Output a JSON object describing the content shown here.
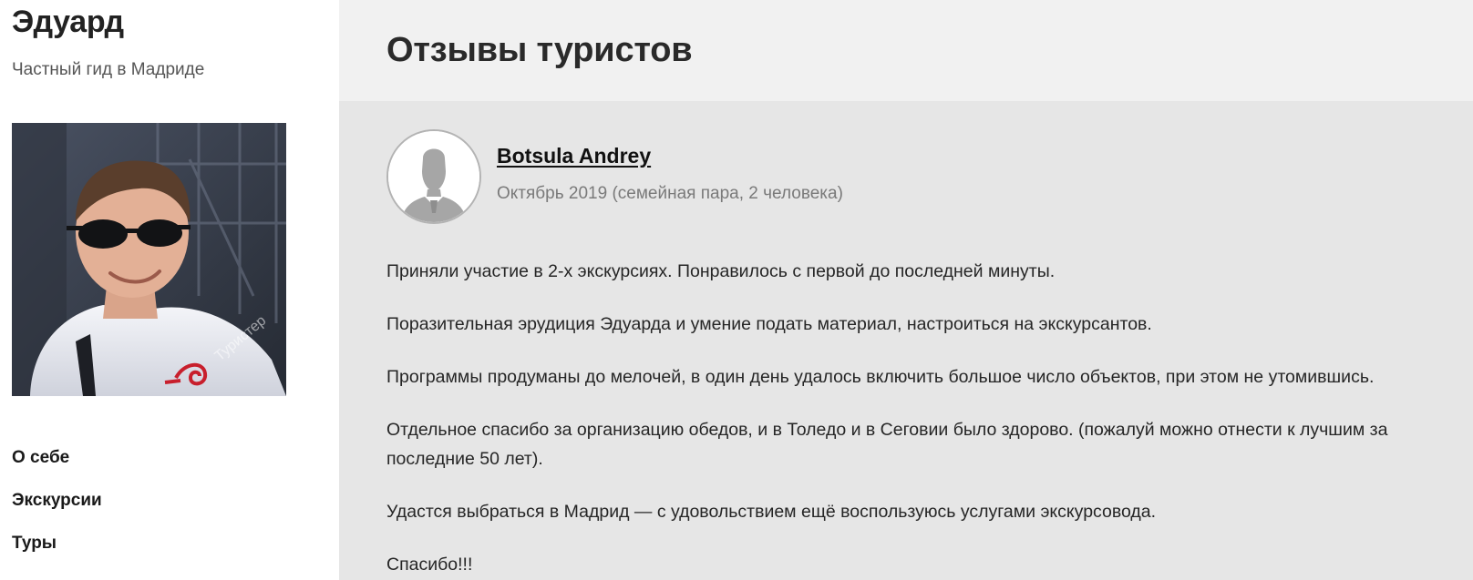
{
  "sidebar": {
    "guide_name": "Эдуард",
    "guide_subtitle": "Частный гид в Мадриде",
    "photo_watermark": "Туристер",
    "nav": [
      {
        "label": "О себе"
      },
      {
        "label": "Экскурсии"
      },
      {
        "label": "Туры"
      }
    ]
  },
  "main": {
    "title": "Отзывы туристов",
    "review": {
      "author": "Botsula Andrey",
      "meta": "Октябрь 2019 (семейная пара, 2 человека)",
      "paragraphs": [
        "Приняли участие в 2-х экскурсиях. Понравилось с первой до последней минуты.",
        "Поразительная эрудиция Эдуарда и умение подать материал, настроиться на экскурсантов.",
        "Программы продуманы до мелочей, в один день удалось включить большое число объектов, при этом не утомившись.",
        "Отдельное спасибо за организацию обедов, и в Толедо и в Сеговии было здорово. (пожалуй можно отнести к лучшим за последние 50 лет).",
        "Удастся выбраться в Мадрид — с удовольствием ещё воспользуюсь услугами экскурсовода.",
        "Спасибо!!!"
      ]
    }
  },
  "colors": {
    "main_background": "#e6e6e6",
    "header_background": "#f1f1f1",
    "sidebar_background": "#ffffff",
    "meta_text": "#7a7a7a",
    "avatar_silhouette": "#a6a6a6"
  },
  "icons": {
    "avatar": "user-silhouette-icon"
  }
}
